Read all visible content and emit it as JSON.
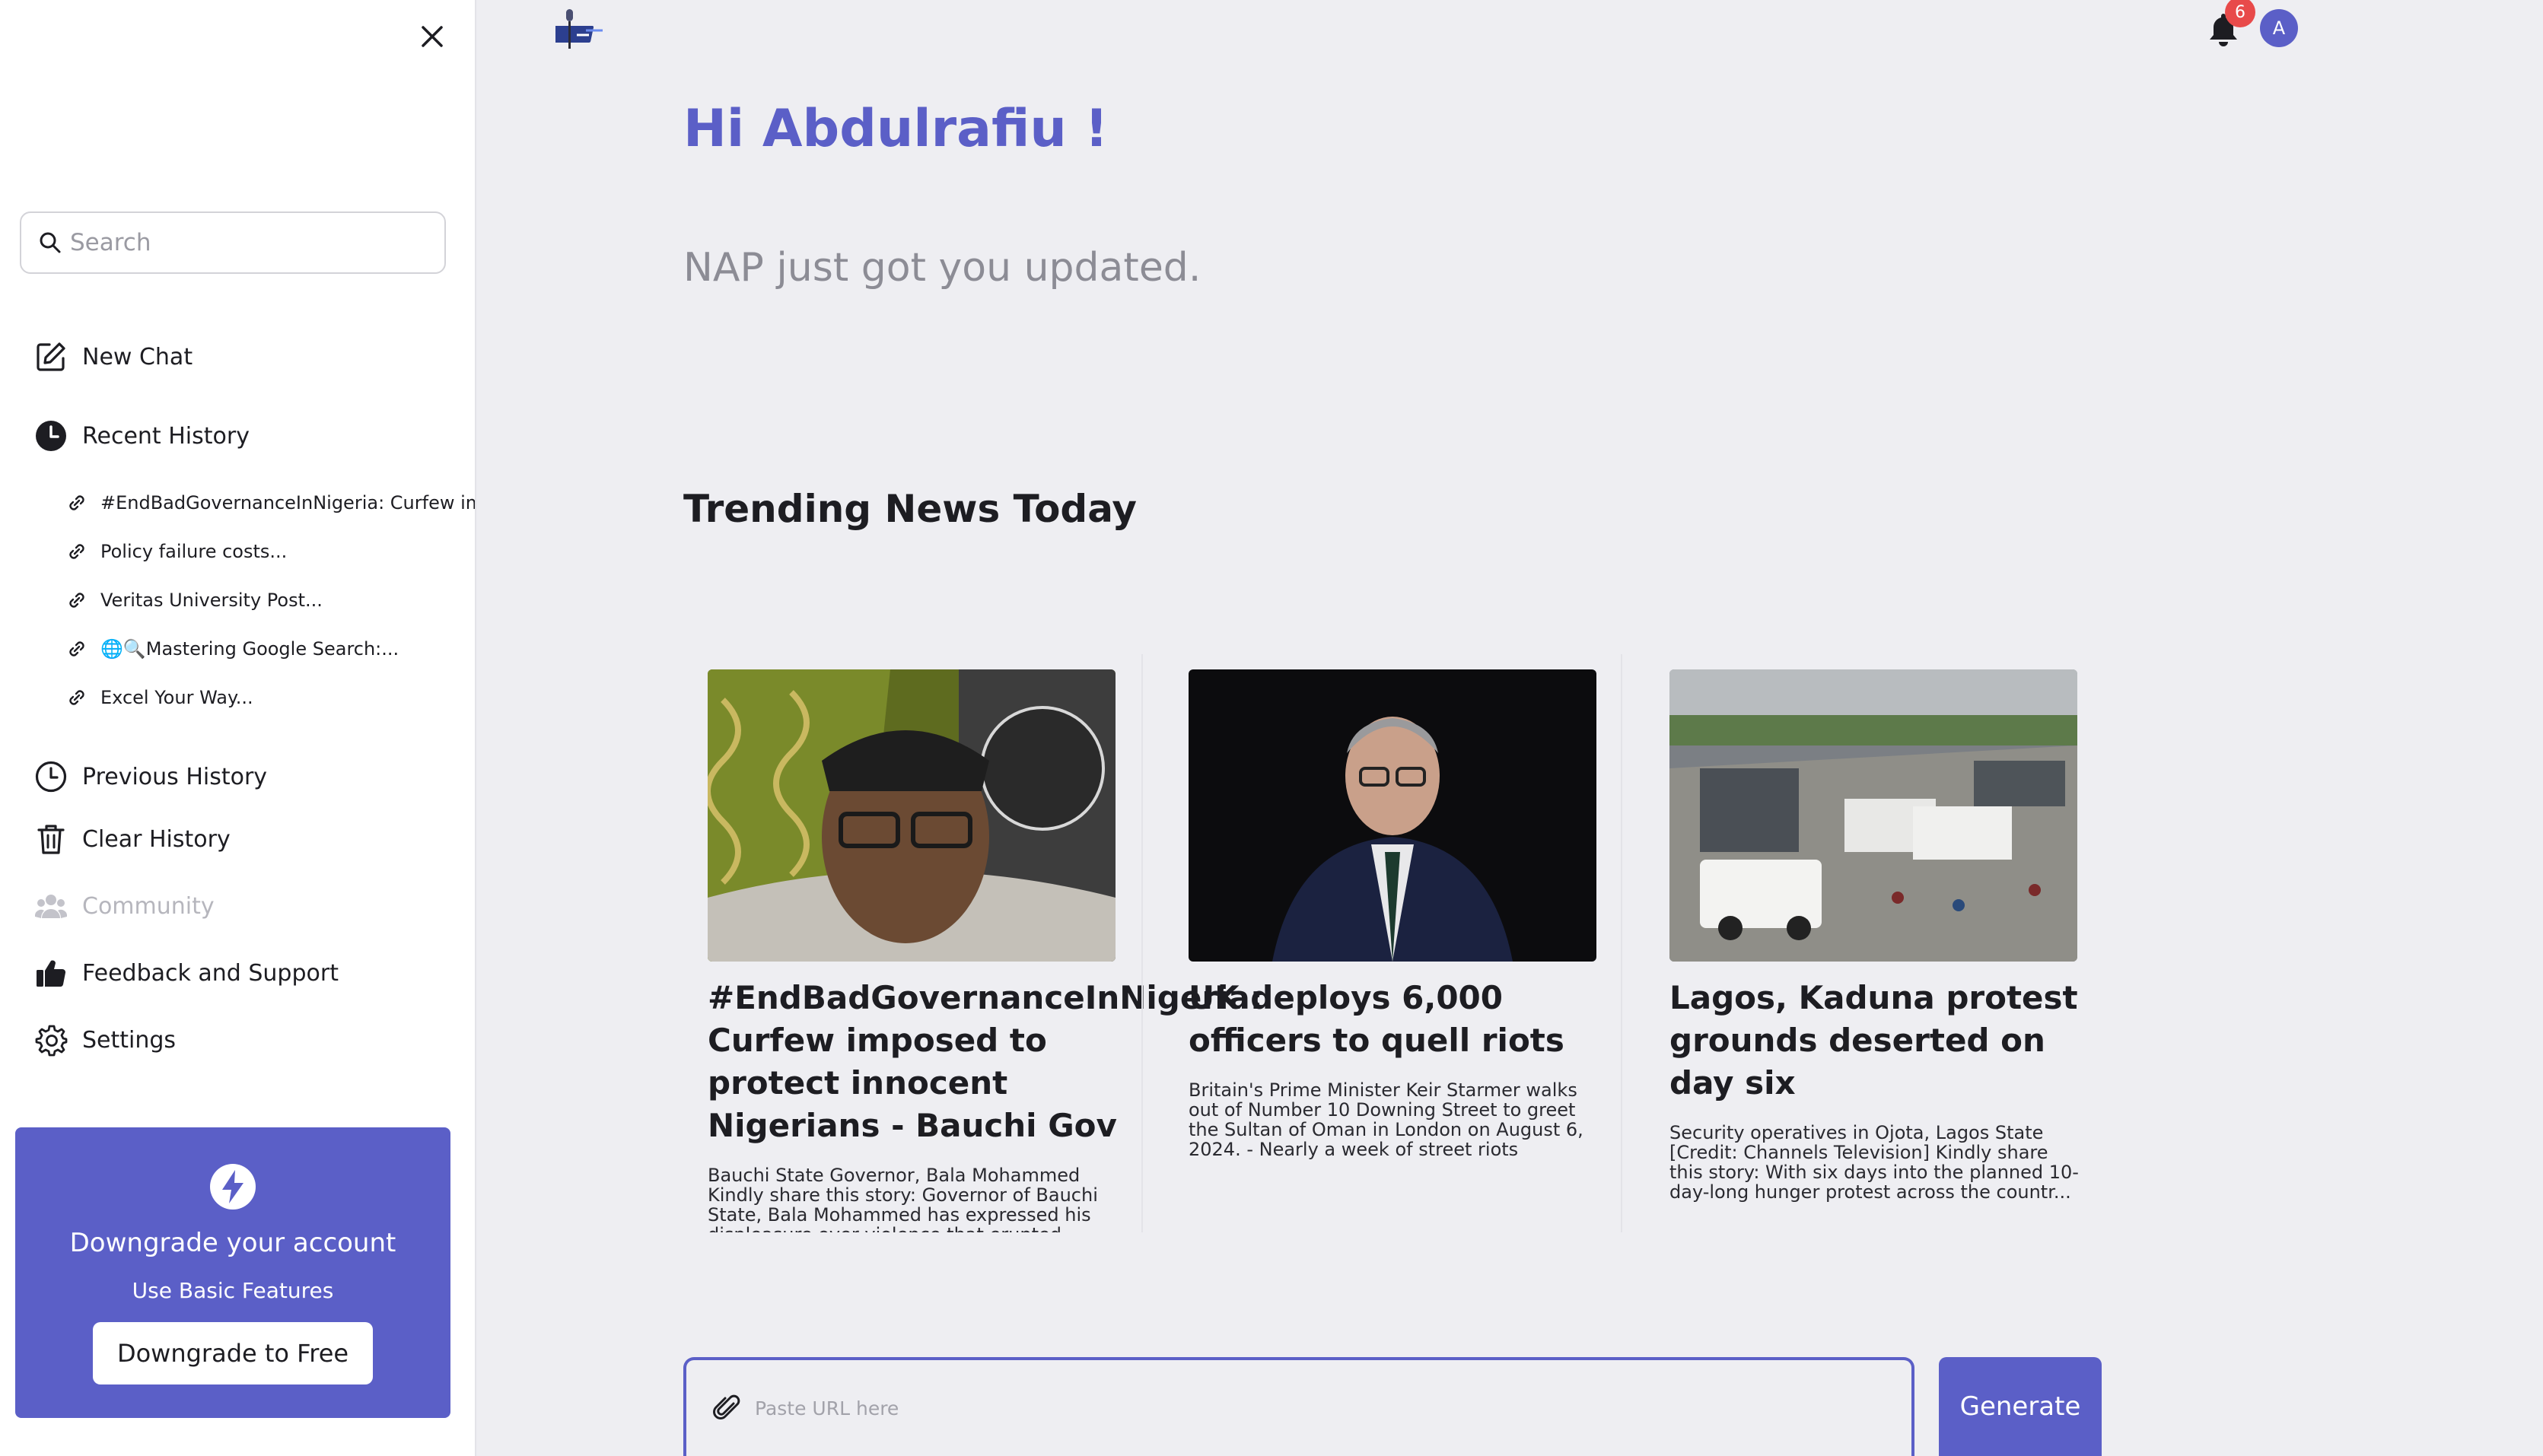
{
  "sidebar": {
    "search": {
      "placeholder": "Search",
      "value": ""
    },
    "new_chat": "New Chat",
    "recent_history": "Recent History",
    "history_items": [
      "#EndBadGovernanceInNigeria: Curfew imposed to protect innocent Nigerians - Bauchi Gov",
      "Policy failure costs...",
      "Veritas University Post...",
      "🌐🔍Mastering Google Search:...",
      "Excel Your Way..."
    ],
    "previous_history": "Previous History",
    "clear_history": "Clear History",
    "community": "Community",
    "feedback": "Feedback and Support",
    "settings": "Settings",
    "promo": {
      "title": "Downgrade your account",
      "subtitle": "Use Basic Features",
      "button": "Downgrade to Free"
    }
  },
  "header": {
    "notification_count": "6",
    "avatar_initial": "A"
  },
  "main": {
    "greeting": "Hi Abdulrafiu !",
    "subtitle": "NAP just got you updated.",
    "section_title": "Trending News Today",
    "cards": [
      {
        "headline": "#EndBadGovernanceInNigeria: Curfew imposed to protect innocent Nigerians - Bauchi Gov",
        "description": "Bauchi State Governor, Bala Mohammed Kindly share this story: Governor of Bauchi State, Bala Mohammed has expressed his displeasure over violence that erupted"
      },
      {
        "headline": "UK deploys 6,000 officers to quell riots",
        "description": "Britain's Prime Minister Keir Starmer walks out of Number 10 Downing Street to greet the Sultan of Oman in London on August 6, 2024. - Nearly a week of street riots across..."
      },
      {
        "headline": "Lagos, Kaduna protest grounds deserted on day six",
        "description": "Security operatives in Ojota, Lagos State [Credit: Channels Television] Kindly share this story: With six days into the planned 10-day-long hunger protest across the countr..."
      }
    ],
    "url_input": {
      "placeholder": "Paste URL here",
      "value": ""
    },
    "generate_button": "Generate"
  },
  "colors": {
    "accent": "#5b5fc7",
    "background": "#eeeef2",
    "badge": "#e84a4a"
  }
}
